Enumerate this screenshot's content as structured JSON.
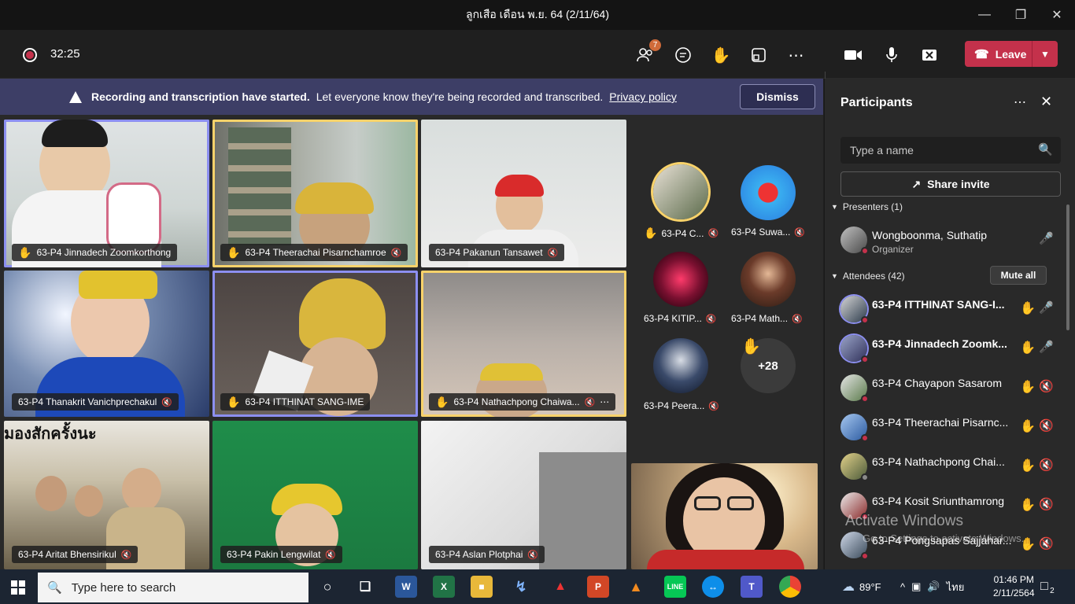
{
  "window": {
    "title": "ลูกเสือ เดือน พ.ย. 64 (2/11/64)"
  },
  "toolbar": {
    "timer": "32:25",
    "participants_badge": "7",
    "leave_label": "Leave"
  },
  "banner": {
    "bold": "Recording and transcription have started.",
    "text": "Let everyone know they're being recorded and transcribed.",
    "link": "Privacy policy",
    "dismiss": "Dismiss"
  },
  "tiles": [
    {
      "name": "63-P4 Jinnadech Zoomkorthong",
      "hand": true,
      "muted": false
    },
    {
      "name": "63-P4 Theerachai Pisarnchamroe",
      "hand": true,
      "muted": true
    },
    {
      "name": "63-P4 Pakanun Tansawet",
      "hand": false,
      "muted": true
    },
    {
      "name": "63-P4 Thanakrit Vanichprechakul",
      "hand": false,
      "muted": true
    },
    {
      "name": "63-P4 ITTHINAT SANG-IME",
      "hand": true,
      "muted": false
    },
    {
      "name": "63-P4 Nathachpong Chaiwa...",
      "hand": true,
      "muted": true
    },
    {
      "name": "63-P4 Aritat Bhensirikul",
      "hand": false,
      "muted": true
    },
    {
      "name": "63-P4 Pakin Lengwilat",
      "hand": false,
      "muted": true
    },
    {
      "name": "63-P4 Aslan Plotphai",
      "hand": false,
      "muted": true
    }
  ],
  "tile_overlay_text": "มองสักครั้งนะ",
  "avatars": [
    {
      "name": "63-P4 C...",
      "hand": true
    },
    {
      "name": "63-P4 Suwa...",
      "hand": false
    },
    {
      "name": "63-P4 KITIP...",
      "hand": false
    },
    {
      "name": "63-P4 Math...",
      "hand": false
    },
    {
      "name": "63-P4 Peera...",
      "hand": false
    }
  ],
  "more_count": "+28",
  "panel": {
    "title": "Participants",
    "search_placeholder": "Type a name",
    "share_invite": "Share invite",
    "presenters_label": "Presenters (1)",
    "attendees_label": "Attendees (42)",
    "mute_all": "Mute all",
    "presenter": {
      "name": "Wongboonma, Suthatip",
      "role": "Organizer"
    },
    "attendees": [
      {
        "name": "63-P4 ITTHINAT SANG-I...",
        "mic": "on"
      },
      {
        "name": "63-P4 Jinnadech Zoomk...",
        "mic": "on"
      },
      {
        "name": "63-P4 Chayapon Sasarom",
        "mic": "off"
      },
      {
        "name": "63-P4 Theerachai Pisarnc...",
        "mic": "off"
      },
      {
        "name": "63-P4 Nathachpong Chai...",
        "mic": "off"
      },
      {
        "name": "63-P4 Kosit Sriunthamrong",
        "mic": "off"
      },
      {
        "name": "63-P4 Pongsapas Sajjahar...",
        "mic": "off"
      }
    ]
  },
  "watermark": {
    "line1": "Activate Windows",
    "line2": "Go to Settings to activate Windows."
  },
  "taskbar": {
    "search_placeholder": "Type here to search",
    "weather": "89°F",
    "lang": "ไทย",
    "time": "01:46 PM",
    "date": "2/11/2564",
    "notifications": "2"
  }
}
